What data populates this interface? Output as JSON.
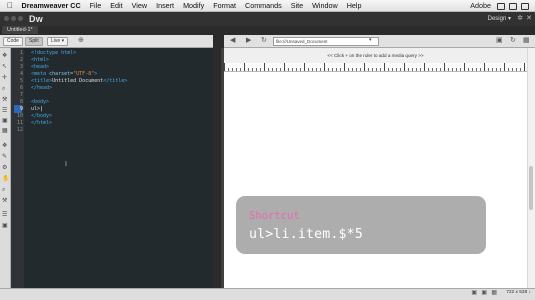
{
  "menubar": {
    "apple": "",
    "items": [
      "Dreamweaver CC",
      "File",
      "Edit",
      "View",
      "Insert",
      "Modify",
      "Format",
      "Commands",
      "Site",
      "Window",
      "Help"
    ],
    "right": "Adobe"
  },
  "app": {
    "logo": "Dw",
    "workspace": "Design",
    "workspace_arrow": "▾",
    "gear": "✲",
    "close": "✕"
  },
  "document_tab": {
    "label": "Untitled-1*"
  },
  "toolbar": {
    "code_label": "Code",
    "split_label": "Split",
    "live_label": "Live",
    "live_arrow": "▾",
    "address": "file:///Unsaved_Document",
    "address_arrow": "▾"
  },
  "media_query_hint": "<< Click + on the ruler to add a media query >>",
  "code": {
    "current_line": 9,
    "line_numbers": [
      "1",
      "2",
      "3",
      "4",
      "5",
      "6",
      "7",
      "8",
      "9",
      "10",
      "11",
      "12"
    ],
    "lines": {
      "l1_open": "<!doctype html>",
      "l2": "<html>",
      "l3": "<head>",
      "l4_tag": "<meta ",
      "l4_attr": "charset=",
      "l4_val": "\"UTF-8\"",
      "l4_close": ">",
      "l5_open": "<title>",
      "l5_text": "Untitled Document",
      "l5_close": "</title>",
      "l6": "</head>",
      "l8": "<body>",
      "l9": "ul>",
      "l10": "</body>",
      "l11": "</html>"
    }
  },
  "overlay": {
    "label": "Shortcut",
    "code": "ul>li.item.$*5"
  },
  "status": {
    "size": "722 x 538 ↓"
  },
  "icons": {
    "select": "↖",
    "hand": "✋",
    "zoom": "⌕",
    "snippet": "❖",
    "move": "✛",
    "dropper": "✎",
    "back": "◀",
    "forward": "▶",
    "refresh": "↻",
    "home": "⌂",
    "inspect": "⊕",
    "list": "☰",
    "box": "▣",
    "gear": "⚙",
    "tool": "⚒",
    "grid": "▦"
  },
  "colors": {
    "accent": "#2d67b7",
    "overlay_label": "#e968ae",
    "tag": "#46a9e0",
    "string": "#db8a4b"
  }
}
